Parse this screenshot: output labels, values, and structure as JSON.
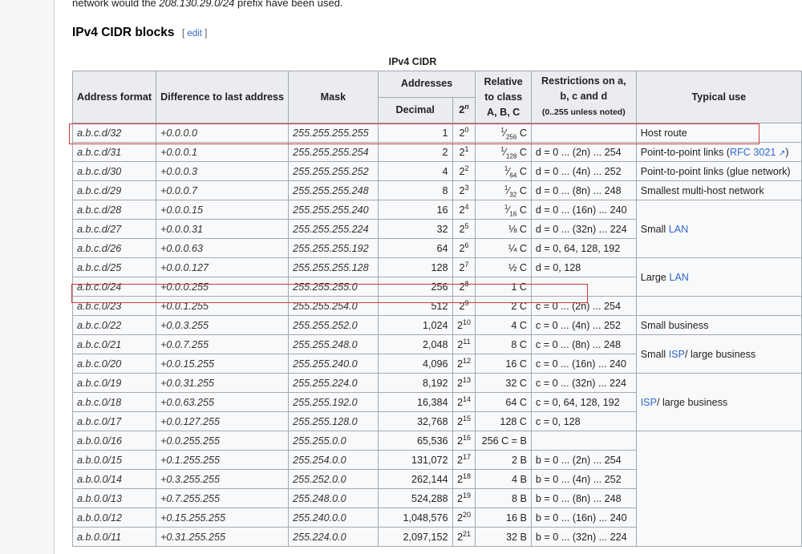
{
  "intro": {
    "before": "network would the ",
    "prefix": "208.130.29.0/24",
    "after": " prefix have been used."
  },
  "section": {
    "title": "IPv4 CIDR blocks",
    "edit_open": "[ ",
    "edit_label": "edit",
    "edit_close": " ]"
  },
  "table": {
    "caption": "IPv4 CIDR",
    "headers": {
      "address_format": "Address format",
      "difference": "Difference to last address",
      "mask": "Mask",
      "addresses": "Addresses",
      "decimal": "Decimal",
      "pow2_base": "2",
      "pow2_exp": "n",
      "relative": "Relative to class A, B, C",
      "restrictions": "Restrictions on a, b, c and d",
      "restrictions_note": "(0..255 unless noted)",
      "typical_use": "Typical use"
    },
    "rows": [
      {
        "fmt": "a.b.c.d/32",
        "diff": "+0.0.0.0",
        "mask": "255.255.255.255",
        "dec": "1",
        "exp": "0",
        "rel_num": "1",
        "rel_den": "256",
        "rel_cls": "C",
        "restr": ""
      },
      {
        "fmt": "a.b.c.d/31",
        "diff": "+0.0.0.1",
        "mask": "255.255.255.254",
        "dec": "2",
        "exp": "1",
        "rel_num": "1",
        "rel_den": "128",
        "rel_cls": "C",
        "restr": "d = 0 ... (2n) ... 254"
      },
      {
        "fmt": "a.b.c.d/30",
        "diff": "+0.0.0.3",
        "mask": "255.255.255.252",
        "dec": "4",
        "exp": "2",
        "rel_num": "1",
        "rel_den": "64",
        "rel_cls": "C",
        "restr": "d = 0 ... (4n) ... 252"
      },
      {
        "fmt": "a.b.c.d/29",
        "diff": "+0.0.0.7",
        "mask": "255.255.255.248",
        "dec": "8",
        "exp": "3",
        "rel_num": "1",
        "rel_den": "32",
        "rel_cls": "C",
        "restr": "d = 0 ... (8n) ... 248"
      },
      {
        "fmt": "a.b.c.d/28",
        "diff": "+0.0.0.15",
        "mask": "255.255.255.240",
        "dec": "16",
        "exp": "4",
        "rel_num": "1",
        "rel_den": "16",
        "rel_cls": "C",
        "restr": "d = 0 ... (16n) ... 240"
      },
      {
        "fmt": "a.b.c.d/27",
        "diff": "+0.0.0.31",
        "mask": "255.255.255.224",
        "dec": "32",
        "exp": "5",
        "rel": "⅛ C",
        "restr": "d = 0 ... (32n) ... 224"
      },
      {
        "fmt": "a.b.c.d/26",
        "diff": "+0.0.0.63",
        "mask": "255.255.255.192",
        "dec": "64",
        "exp": "6",
        "rel": "¼ C",
        "restr": "d = 0, 64, 128, 192"
      },
      {
        "fmt": "a.b.c.d/25",
        "diff": "+0.0.0.127",
        "mask": "255.255.255.128",
        "dec": "128",
        "exp": "7",
        "rel": "½ C",
        "restr": "d = 0, 128"
      },
      {
        "fmt": "a.b.c.0/24",
        "diff": "+0.0.0.255",
        "mask": "255.255.255.0",
        "dec": "256",
        "exp": "8",
        "rel": "1 C",
        "restr": ""
      },
      {
        "fmt": "a.b.c.0/23",
        "diff": "+0.0.1.255",
        "mask": "255.255.254.0",
        "dec": "512",
        "exp": "9",
        "rel": "2 C",
        "restr": "c = 0 ... (2n) ... 254"
      },
      {
        "fmt": "a.b.c.0/22",
        "diff": "+0.0.3.255",
        "mask": "255.255.252.0",
        "dec": "1,024",
        "exp": "10",
        "rel": "4 C",
        "restr": "c = 0 ... (4n) ... 252"
      },
      {
        "fmt": "a.b.c.0/21",
        "diff": "+0.0.7.255",
        "mask": "255.255.248.0",
        "dec": "2,048",
        "exp": "11",
        "rel": "8 C",
        "restr": "c = 0 ... (8n) ... 248"
      },
      {
        "fmt": "a.b.c.0/20",
        "diff": "+0.0.15.255",
        "mask": "255.255.240.0",
        "dec": "4,096",
        "exp": "12",
        "rel": "16 C",
        "restr": "c = 0 ... (16n) ... 240"
      },
      {
        "fmt": "a.b.c.0/19",
        "diff": "+0.0.31.255",
        "mask": "255.255.224.0",
        "dec": "8,192",
        "exp": "13",
        "rel": "32 C",
        "restr": "c = 0 ... (32n) ... 224"
      },
      {
        "fmt": "a.b.c.0/18",
        "diff": "+0.0.63.255",
        "mask": "255.255.192.0",
        "dec": "16,384",
        "exp": "14",
        "rel": "64 C",
        "restr": "c = 0, 64, 128, 192"
      },
      {
        "fmt": "a.b.c.0/17",
        "diff": "+0.0.127.255",
        "mask": "255.255.128.0",
        "dec": "32,768",
        "exp": "15",
        "rel": "128 C",
        "restr": "c = 0, 128"
      },
      {
        "fmt": "a.b.0.0/16",
        "diff": "+0.0.255.255",
        "mask": "255.255.0.0",
        "dec": "65,536",
        "exp": "16",
        "rel": "256 C = B",
        "restr": ""
      },
      {
        "fmt": "a.b.0.0/15",
        "diff": "+0.1.255.255",
        "mask": "255.254.0.0",
        "dec": "131,072",
        "exp": "17",
        "rel": "2 B",
        "restr": "b = 0 ... (2n) ... 254"
      },
      {
        "fmt": "a.b.0.0/14",
        "diff": "+0.3.255.255",
        "mask": "255.252.0.0",
        "dec": "262,144",
        "exp": "18",
        "rel": "4 B",
        "restr": "b = 0 ... (4n) ... 252"
      },
      {
        "fmt": "a.b.0.0/13",
        "diff": "+0.7.255.255",
        "mask": "255.248.0.0",
        "dec": "524,288",
        "exp": "19",
        "rel": "8 B",
        "restr": "b = 0 ... (8n) ... 248"
      },
      {
        "fmt": "a.b.0.0/12",
        "diff": "+0.15.255.255",
        "mask": "255.240.0.0",
        "dec": "1,048,576",
        "exp": "20",
        "rel": "16 B",
        "restr": "b = 0 ... (16n) ... 240"
      },
      {
        "fmt": "a.b.0.0/11",
        "diff": "+0.31.255.255",
        "mask": "255.224.0.0",
        "dec": "2,097,152",
        "exp": "21",
        "rel": "32 B",
        "restr": "b = 0 ... (32n) ... 224"
      }
    ],
    "uses": {
      "host_route": "Host route",
      "p2p_prefix": "Point-to-point links (",
      "rfc_link": "RFC 3021",
      "p2p_suffix": ")",
      "p2p_glue": "Point-to-point links (glue network)",
      "smallest_multihost": "Smallest multi-host network",
      "small_prefix": "Small ",
      "lan_link": "LAN",
      "large_prefix": "Large ",
      "small_business": "Small business",
      "isp_link": "ISP",
      "small_isp_suffix": "/ large business",
      "isp_suffix": "/ large business",
      "small_label": "Small "
    }
  },
  "colors": {
    "link": "#3366cc",
    "highlight": "#d03a3a",
    "header_bg": "#eaecf0",
    "cell_bg": "#f8f9fa"
  }
}
